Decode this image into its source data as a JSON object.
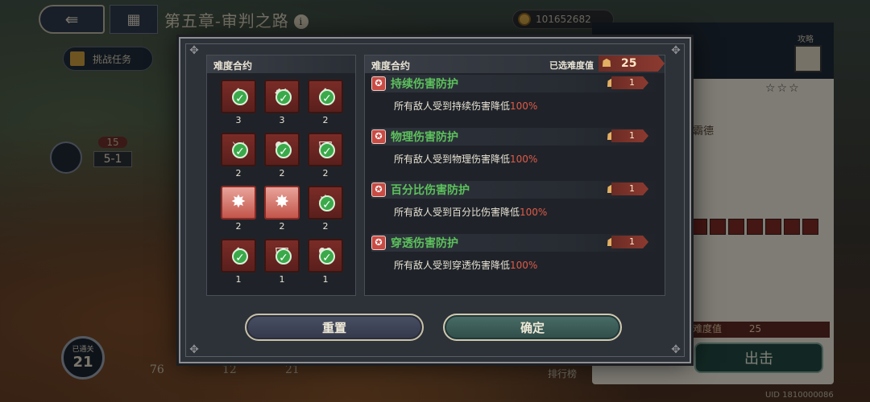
{
  "topbar": {
    "back_icon": "back-arrow-icon",
    "menu_icon": "grid-menu-icon",
    "chapter_title": "第五章-审判之路",
    "currency_value": "101652682"
  },
  "map": {
    "task_button": "挑战任务",
    "stage_count": "15",
    "stage_label": "5-1",
    "progress_label": "已通关",
    "progress_value": "21",
    "bottom_num_1": "76",
    "bottom_num_2": "12",
    "bottom_num_3": "21",
    "rank_label": "排行榜"
  },
  "side": {
    "strategy_label": "攻略",
    "right_text": "霸德",
    "diff_label": "难度值",
    "diff_value": "25",
    "fight_button": "出击",
    "uid": "UID 1810000086"
  },
  "modal": {
    "left_title": "难度合约",
    "right_title": "难度合约",
    "selected_label": "已选难度值",
    "selected_value": "25",
    "contracts": [
      {
        "glyph": "⬆",
        "value": "3",
        "checked": true,
        "red": false
      },
      {
        "glyph": "⚒",
        "value": "3",
        "checked": true,
        "red": false
      },
      {
        "glyph": "⬆",
        "value": "2",
        "checked": true,
        "red": false
      },
      {
        "glyph": "⚔",
        "value": "2",
        "checked": true,
        "red": false
      },
      {
        "glyph": "♥",
        "value": "2",
        "checked": true,
        "red": false
      },
      {
        "glyph": "⛨",
        "value": "2",
        "checked": true,
        "red": false
      },
      {
        "glyph": "✸",
        "value": "2",
        "checked": false,
        "red": true
      },
      {
        "glyph": "✸",
        "value": "2",
        "checked": false,
        "red": true
      },
      {
        "glyph": "✸",
        "value": "2",
        "checked": true,
        "red": false
      },
      {
        "glyph": "⬆",
        "value": "1",
        "checked": true,
        "red": false
      },
      {
        "glyph": "⛨",
        "value": "1",
        "checked": true,
        "red": false
      },
      {
        "glyph": "♥",
        "value": "1",
        "checked": true,
        "red": false
      }
    ],
    "entries": [
      {
        "title": "持续伤害防护",
        "desc": "所有敌人受到持续伤害降低",
        "pct": "100%",
        "value": "1"
      },
      {
        "title": "物理伤害防护",
        "desc": "所有敌人受到物理伤害降低",
        "pct": "100%",
        "value": "1"
      },
      {
        "title": "百分比伤害防护",
        "desc": "所有敌人受到百分比伤害降低",
        "pct": "100%",
        "value": "1"
      },
      {
        "title": "穿透伤害防护",
        "desc": "所有敌人受到穿透伤害降低",
        "pct": "100%",
        "value": "1"
      }
    ],
    "reset_button": "重置",
    "confirm_button": "确定"
  }
}
